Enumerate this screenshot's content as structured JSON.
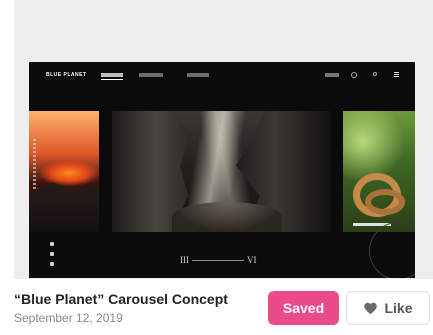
{
  "shot": {
    "title": "“Blue Planet” Carousel Concept",
    "date": "September 12, 2019",
    "preview": {
      "brand": "BLUE PLANET",
      "pager_start": "III",
      "pager_end": "VI"
    }
  },
  "actions": {
    "saved_label": "Saved",
    "like_label": "Like",
    "saved_color": "#ea4c89"
  },
  "icons": {
    "like": "heart-icon"
  }
}
